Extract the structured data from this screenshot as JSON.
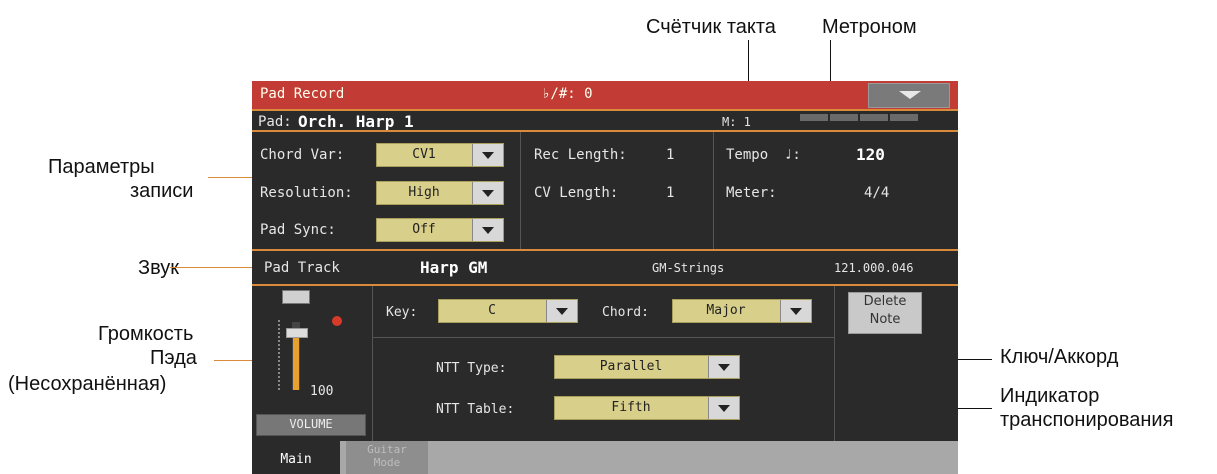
{
  "annotations": {
    "bar_counter": "Счётчик такта",
    "metronome": "Метроном",
    "rec_params_line1": "Параметры",
    "rec_params_line2": "записи",
    "sound": "Звук",
    "volume_line1": "Громкость",
    "volume_line2": "Пэда",
    "volume_line3": "(Несохранённая)",
    "key_chord": "Ключ/Аккорд",
    "transpose_line1": "Индикатор",
    "transpose_line2": "транспонирования"
  },
  "header": {
    "title": "Pad Record",
    "key_signature": "♭/#: 0"
  },
  "pad_row": {
    "label": "Pad:",
    "name": "Orch. Harp 1",
    "measure": "M: 1"
  },
  "params": {
    "chord_var_label": "Chord Var:",
    "chord_var_value": "CV1",
    "resolution_label": "Resolution:",
    "resolution_value": "High",
    "pad_sync_label": "Pad Sync:",
    "pad_sync_value": "Off",
    "rec_length_label": "Rec Length:",
    "rec_length_value": "1",
    "cv_length_label": "CV Length:",
    "cv_length_value": "1",
    "tempo_label": "Tempo",
    "tempo_note": "♩:",
    "tempo_value": "120",
    "meter_label": "Meter:",
    "meter_value": "4/4"
  },
  "track": {
    "label": "Pad Track",
    "sound": "Harp GM",
    "bank": "GM-Strings",
    "program": "121.000.046"
  },
  "mixer": {
    "volume_value": "100",
    "volume_label": "VOLUME",
    "mute_icon": "mute-solo-icon",
    "volume_level": 100
  },
  "key_chord": {
    "key_label": "Key:",
    "key_value": "C",
    "chord_label": "Chord:",
    "chord_value": "Major",
    "ntt_type_label": "NTT Type:",
    "ntt_type_value": "Parallel",
    "ntt_table_label": "NTT Table:",
    "ntt_table_value": "Fifth"
  },
  "delete_button": {
    "line1": "Delete",
    "line2": "Note"
  },
  "tabs": {
    "main": "Main",
    "guitar_line1": "Guitar",
    "guitar_line2": "Mode"
  },
  "colors": {
    "accent": "#d98a3a",
    "title_bar": "#c23b34",
    "screen_bg": "#2a2a2a",
    "dropdown": "#d8cf8a"
  }
}
